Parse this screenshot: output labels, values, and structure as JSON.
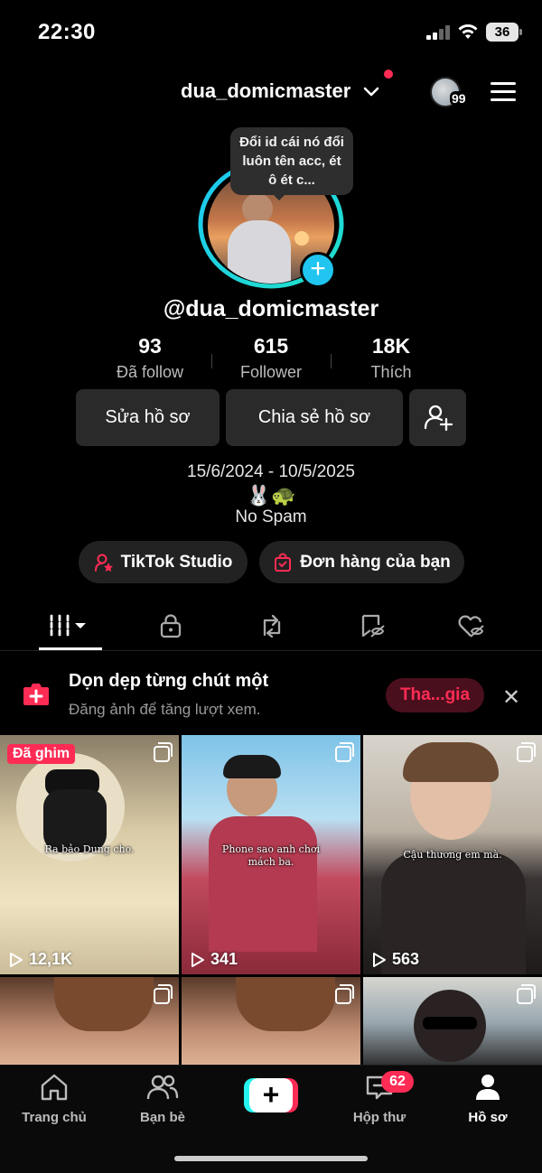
{
  "status_bar": {
    "time": "22:30",
    "battery": "36"
  },
  "header": {
    "username": "dua_domicmaster",
    "friends_badge": "99"
  },
  "profile": {
    "note_bubble": "Đổi id cái nó đổi luôn tên acc, ét ô ét c...",
    "handle": "@dua_domicmaster",
    "stats": [
      {
        "value": "93",
        "label": "Đã follow"
      },
      {
        "value": "615",
        "label": "Follower"
      },
      {
        "value": "18K",
        "label": "Thích"
      }
    ],
    "edit_button": "Sửa hồ sơ",
    "share_button": "Chia sẻ hồ sơ",
    "bio_dates": "15/6/2024 - 10/5/2025",
    "bio_emojis": "🐰🐢",
    "bio_text": "No Spam",
    "studio_link": "TikTok Studio",
    "orders_link": "Đơn hàng của bạn"
  },
  "tabs": [
    "videos-icon",
    "lock-icon",
    "repost-icon",
    "favorites-icon",
    "liked-icon"
  ],
  "banner": {
    "title": "Dọn dẹp từng chút một",
    "subtitle": "Đăng ảnh để tăng lượt xem.",
    "join_button": "Tha...gia"
  },
  "grid": {
    "pinned_label": "Đã ghim",
    "videos": [
      {
        "caption": "Ra bảo Dung cho.",
        "views": "12,1K"
      },
      {
        "caption": "Phone sao anh chơi mách ba.",
        "views": "341"
      },
      {
        "caption": "Cậu thương em mà.",
        "views": "563"
      },
      {
        "caption": "",
        "views": ""
      },
      {
        "caption": "",
        "views": ""
      },
      {
        "caption": "",
        "views": ""
      }
    ]
  },
  "bottom_nav": {
    "home": "Trang chủ",
    "friends": "Bạn bè",
    "create": "+",
    "inbox": "Hộp thư",
    "inbox_badge": "62",
    "profile": "Hồ sơ"
  },
  "colors": {
    "accent": "#fe2c55",
    "cyan": "#25f4ee",
    "background": "#000000"
  }
}
